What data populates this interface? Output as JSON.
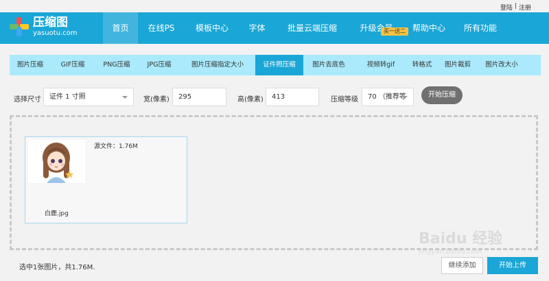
{
  "topbar": {
    "login": "登陆",
    "sep": "|",
    "register": "注册"
  },
  "logo": {
    "name": "压缩图",
    "domain": "yasuotu.com"
  },
  "nav": {
    "items": [
      "首页",
      "在线PS",
      "模板中心",
      "字体",
      "批量云端压缩",
      "升级会员",
      "帮助中心",
      "所有功能"
    ],
    "promo": "买一送二",
    "active_index": 0
  },
  "subnav": {
    "items": [
      "图片压缩",
      "GIF压缩",
      "PNG压缩",
      "JPG压缩",
      "图片压缩指定大小",
      "证件照压缩",
      "图片去底色",
      "视频转gif",
      "转格式",
      "图片裁剪",
      "图片改大小"
    ],
    "active_index": 5
  },
  "options": {
    "size_label": "选择尺寸",
    "size_value": "证件 1 寸照",
    "width_label": "宽(像素)",
    "width_value": "295",
    "height_label": "高(像素)",
    "height_value": "413",
    "level_label": "压缩等级",
    "level_value": "70 （推荐等",
    "start_button": "开始压缩"
  },
  "file": {
    "source_info": "源文件：1.76M",
    "name": "白鹿.jpg"
  },
  "footer": {
    "status": "选中1张图片，共1.76M.",
    "continue_button": "继续添加",
    "upload_button": "开始上传"
  },
  "watermark": {
    "text": "Baidu 经验",
    "sub": "jingyan.baidu.com"
  },
  "colors": {
    "brand": "#1aa6d6",
    "subnav_bg": "#aaeafc",
    "promo": "#f5c243",
    "start_button": "#707070"
  }
}
